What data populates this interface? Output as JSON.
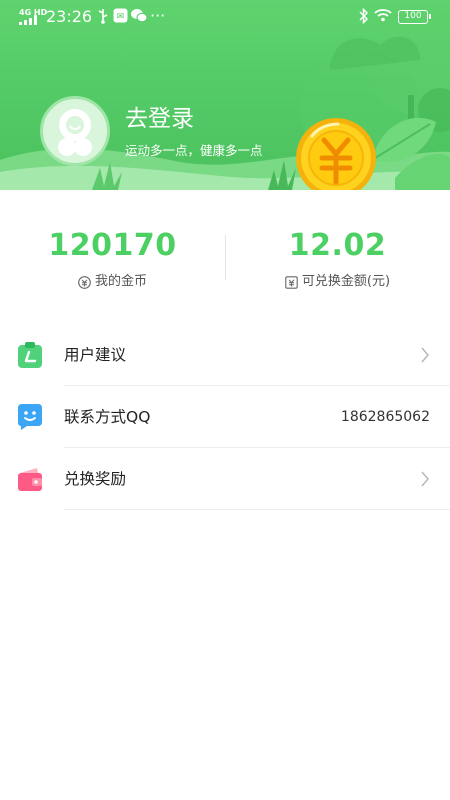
{
  "status_bar": {
    "network": "4G HD",
    "time": "23:26",
    "battery": "100"
  },
  "profile": {
    "login_title": "去登录",
    "subtitle": "运动多一点，健康多一点"
  },
  "stats": {
    "coins_value": "120170",
    "coins_label": "我的金币",
    "exchange_value": "12.02",
    "exchange_label": "可兑换金额(元)"
  },
  "menu": {
    "items": [
      {
        "label": "用户建议",
        "icon": "feedback-clipboard-icon",
        "value": ""
      },
      {
        "label": "联系方式QQ",
        "icon": "chat-bubble-icon",
        "value": "1862865062"
      },
      {
        "label": "兑换奖励",
        "icon": "wallet-icon",
        "value": ""
      }
    ]
  },
  "colors": {
    "header_green": "#52c965",
    "accent_green": "#4ccf63",
    "coin_gold": "#ffd21f"
  }
}
